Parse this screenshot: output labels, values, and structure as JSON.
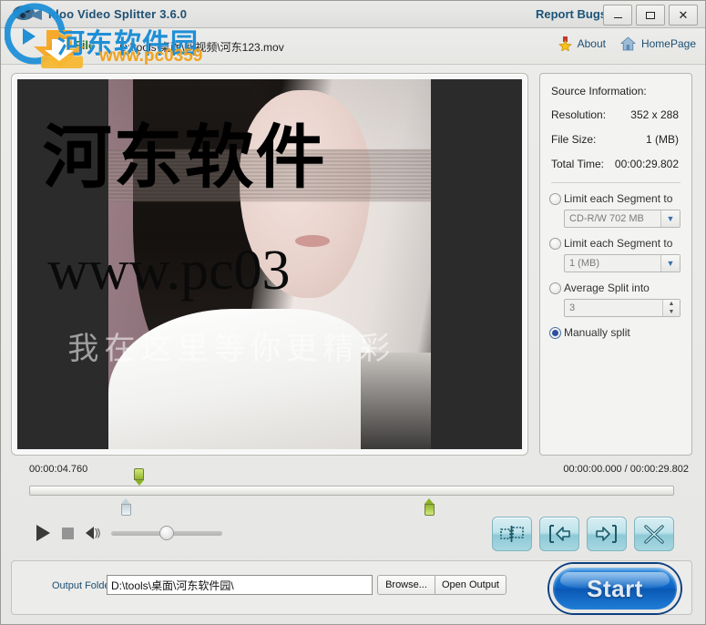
{
  "window": {
    "title": "idoo Video Splitter 3.6.0",
    "report_bugs": "Report Bugs",
    "minimize": "–",
    "maximize": "□",
    "close": "✕"
  },
  "toolbar": {
    "add_file": "Add File .",
    "file_path": "D:\\tools\\桌面\\新视频\\河东123.mov",
    "about": "About",
    "homepage": "HomePage"
  },
  "video": {
    "watermark_big": "河东软件",
    "watermark_url": "www.pc03",
    "watermark_ghost": "我在这里等你更精彩"
  },
  "info": {
    "section_title": "Source Information:",
    "rows": [
      {
        "key": "Resolution:",
        "value": "352 x 288"
      },
      {
        "key": "File Size:",
        "value": "1 (MB)"
      },
      {
        "key": "Total Time:",
        "value": "00:00:29.802"
      }
    ],
    "options": [
      {
        "label": "Limit each Segment to",
        "selected": false,
        "control": "combo",
        "value": "CD-R/W 702 MB"
      },
      {
        "label": "Limit each Segment to",
        "selected": false,
        "control": "combo",
        "value": "1 (MB)"
      },
      {
        "label": "Average Split into",
        "selected": false,
        "control": "spin",
        "value": "3"
      },
      {
        "label": "Manually split",
        "selected": true,
        "control": "none",
        "value": ""
      }
    ]
  },
  "timeline": {
    "current_label": "00:00:04.760",
    "position_total": "00:00:00.000 / 00:00:29.802",
    "playhead_percent": 17,
    "mark_start_percent": 15,
    "mark_end_percent": 62,
    "volume_percent": 50
  },
  "transport": {
    "play": "play-button",
    "stop": "stop-button",
    "volume": "volume-icon",
    "buttons": [
      {
        "name": "split-segment-button"
      },
      {
        "name": "set-start-marker-button"
      },
      {
        "name": "set-end-marker-button"
      },
      {
        "name": "delete-segment-button"
      }
    ]
  },
  "footer": {
    "output_label": "Output Folder:",
    "output_value": "D:\\tools\\桌面\\河东软件园\\",
    "browse": "Browse...",
    "open_output": "Open Output",
    "start": "Start"
  },
  "overlay": {
    "site_name": "河东软件园",
    "site_url": "www.pc0359"
  },
  "colors": {
    "title_text": "#1f4f73",
    "add_file": "#2b6f2f",
    "link": "#1b4f73",
    "accent_button": "#0b63c4",
    "marker_green": "#8fb62b"
  }
}
